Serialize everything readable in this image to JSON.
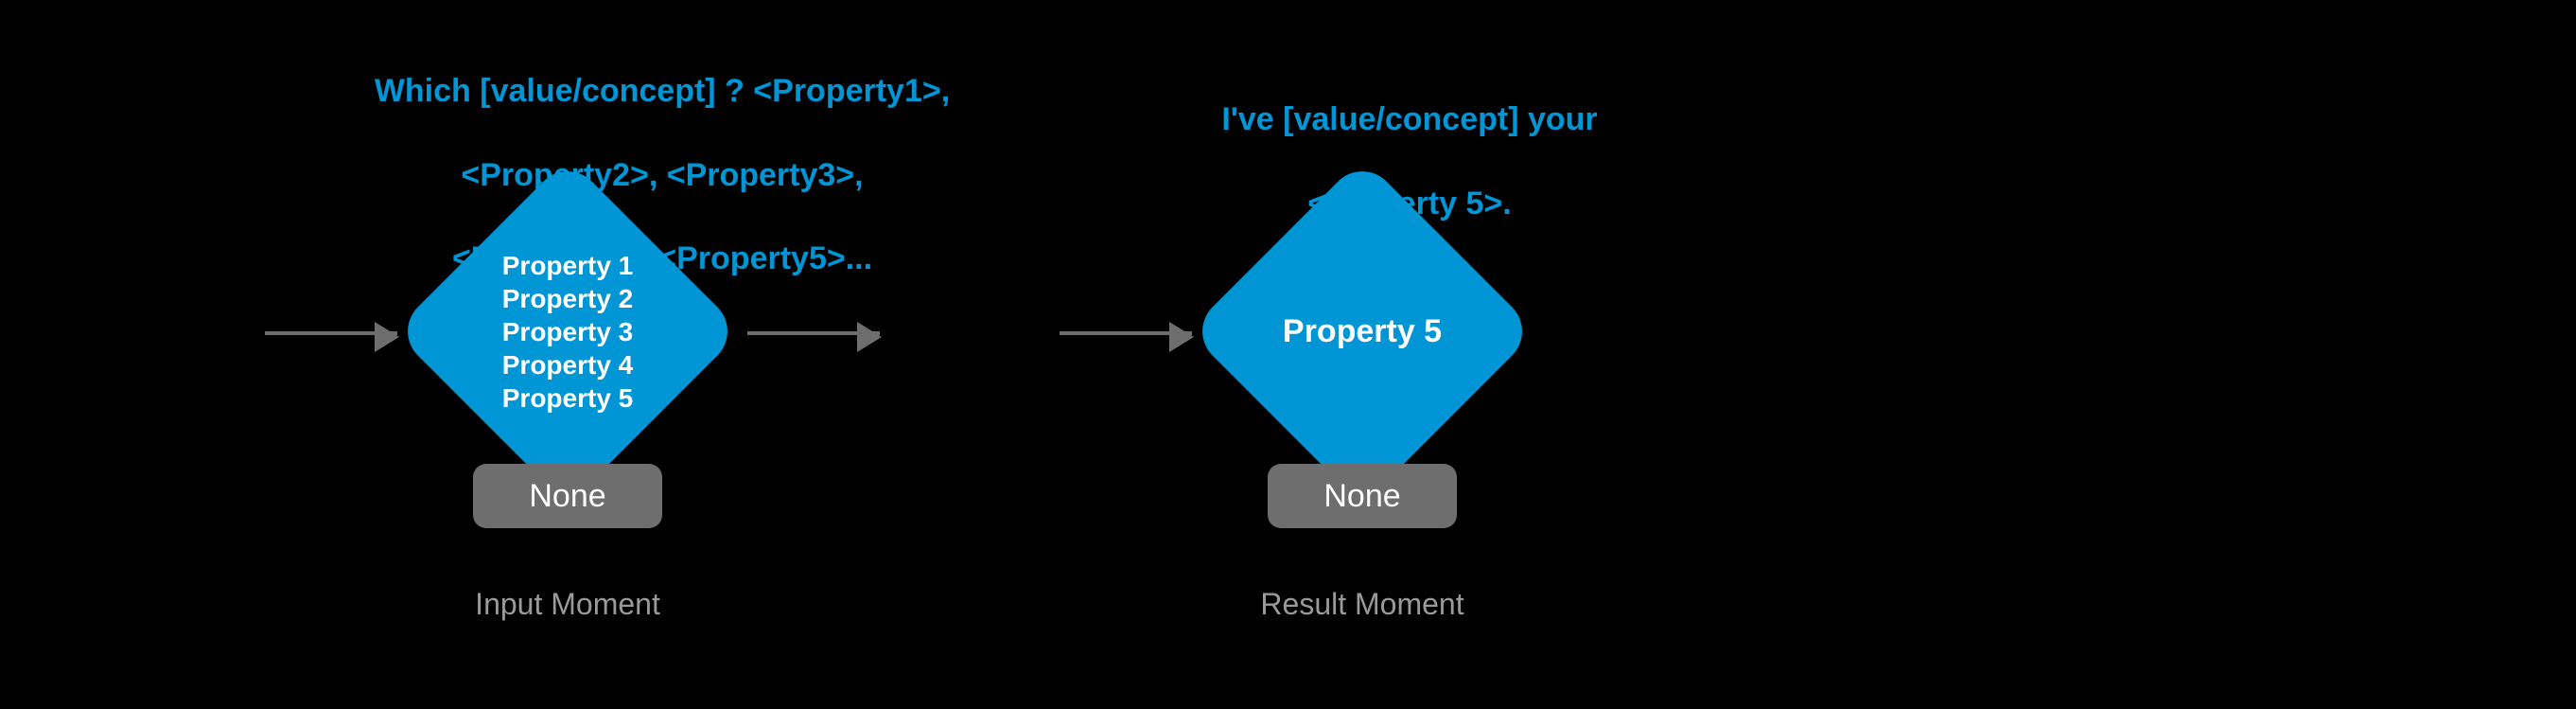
{
  "input": {
    "prompt_line1": "Which [value/concept] ? <Property1>,",
    "prompt_line2": "<Property2>, <Property3>,",
    "prompt_line3": "<Property4>, <Property5>...",
    "properties": [
      "Property 1",
      "Property 2",
      "Property 3",
      "Property 4",
      "Property 5"
    ],
    "none_label": "None",
    "caption": "Input Moment"
  },
  "result": {
    "prompt_line1": "I've  [value/concept] your",
    "prompt_line2": "<property 5>.",
    "selected": "Property 5",
    "none_label": "None",
    "caption": "Result Moment"
  }
}
